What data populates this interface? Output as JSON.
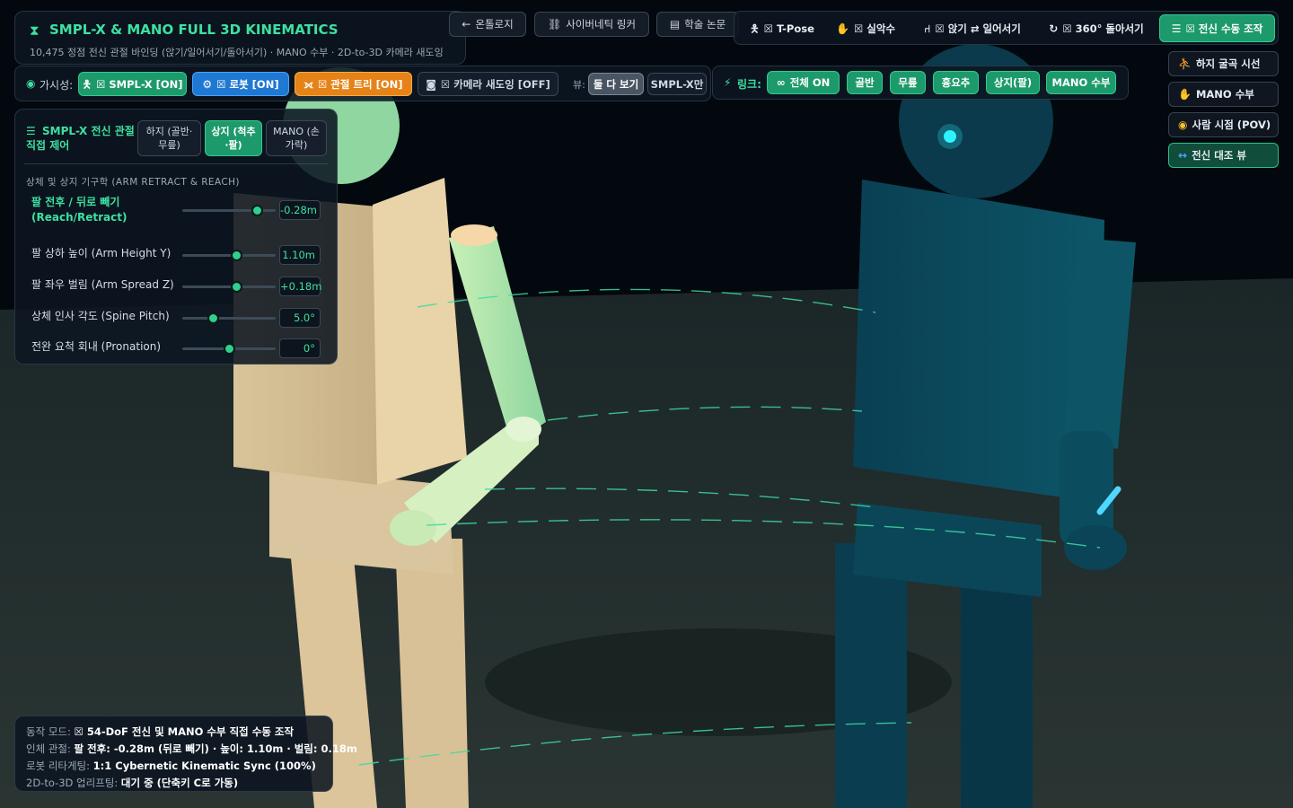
{
  "header": {
    "title": "SMPL-X & MANO FULL 3D KINEMATICS",
    "subtitle": "10,475 정점 전신 관절 바인딩 (앉기/일어서기/돌아서기) · MANO 수부 · 2D-to-3D 카메라 새도잉"
  },
  "nav": {
    "ontology": "온톨로지",
    "cyber_linker": "사이버네틱 링커",
    "paper": "학술 논문"
  },
  "poses": {
    "tpose": "☒ T-Pose",
    "handshake": "☒ 실악수",
    "sit_stand": "☒ 앉기 ⇄ 일어서기",
    "turn360": "☒ 360° 돌아서기",
    "manual": "☒ 전신 수동 조작"
  },
  "visibility": {
    "label": "가시성:",
    "smplx": "☒ SMPL-X [ON]",
    "robot": "☒ 로봇 [ON]",
    "joint_tree": "☒ 관절 트리 [ON]",
    "camera": "☒ 카메라 새도잉 [OFF]",
    "view_label": "뷰:",
    "view_both": "둘 다 보기",
    "view_smplx": "SMPL-X만"
  },
  "link": {
    "label": "링크:",
    "all_on": "전체 ON",
    "pelvis": "골반",
    "knee": "무릎",
    "chest": "흉요추",
    "upper": "상지(팔)",
    "mano": "MANO 수부"
  },
  "side": {
    "lower_gaze": "하지 굴곡 시선",
    "mano_hand": "MANO 수부",
    "pov": "사람 시점 (POV)",
    "compare": "전신 대조 뷰"
  },
  "control": {
    "title": "SMPL-X 전신 관절 직접 제어",
    "tab_lower": "하지 (골반·무릎)",
    "tab_upper": "상지 (척추·팔)",
    "tab_mano": "MANO (손가락)",
    "section": "상체 및 상지 기구학 (ARM RETRACT & REACH)",
    "sliders": [
      {
        "label": "팔 전후 / 뒤로 빼기 (Reach/Retract)",
        "value": "-0.28m",
        "level": 0.8,
        "highlight": true
      },
      {
        "label": "팔 상하 높이 (Arm Height Y)",
        "value": "1.10m",
        "level": 0.58,
        "highlight": false
      },
      {
        "label": "팔 좌우 벌림 (Arm Spread Z)",
        "value": "+0.18m",
        "level": 0.58,
        "highlight": false
      },
      {
        "label": "상체 인사 각도 (Spine Pitch)",
        "value": "5.0°",
        "level": 0.33,
        "highlight": false
      },
      {
        "label": "전완 요척 회내 (Pronation)",
        "value": "0°",
        "level": 0.5,
        "highlight": false
      }
    ]
  },
  "status": {
    "mode_label": "동작 모드:",
    "mode_value": "☒ 54-DoF 전신 및 MANO 수부 직접 수동 조작",
    "joint_label": "인체 관절:",
    "joint_value": "팔 전후: -0.28m (뒤로 빼기) · 높이: 1.10m · 벌림: 0.18m",
    "robot_label": "로봇 리타게팅:",
    "robot_value": "1:1 Cybernetic Kinematic Sync (100%)",
    "lift_label": "2D-to-3D 업리프팅:",
    "lift_value": "대기 중 (단축키 C로 가동)"
  },
  "colors": {
    "accent": "#3ee0a1",
    "human": "#e2cd9c",
    "robot": "#0b4a5e",
    "eye": "#2ff4ff"
  }
}
